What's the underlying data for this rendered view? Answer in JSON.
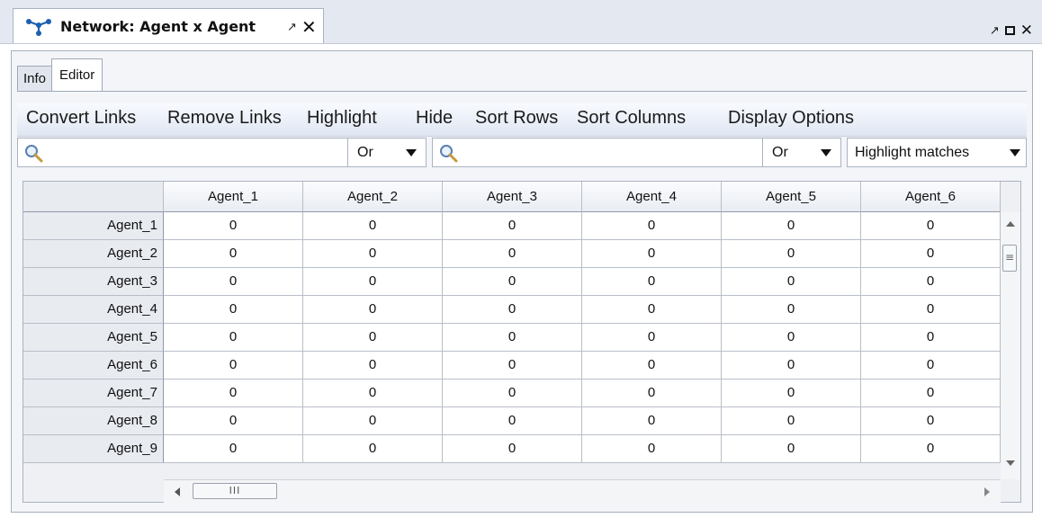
{
  "window": {
    "tab_title": "Network: Agent x Agent",
    "icons": [
      "network-icon",
      "undock-icon",
      "close-icon",
      "maximize-icon"
    ]
  },
  "subtabs": [
    {
      "label": "Info",
      "active": false
    },
    {
      "label": "Editor",
      "active": true
    }
  ],
  "menu": {
    "items": [
      "Convert Links",
      "Remove Links",
      "Highlight",
      "Hide",
      "Sort Rows",
      "Sort Columns",
      "Display Options"
    ]
  },
  "search": {
    "row_filter": {
      "value": "",
      "icon": "search-icon"
    },
    "row_mode": "Or",
    "col_filter": {
      "value": "",
      "icon": "search-icon"
    },
    "col_mode": "Or",
    "highlight_mode": "Highlight matches"
  },
  "grid": {
    "columns": [
      "Agent_1",
      "Agent_2",
      "Agent_3",
      "Agent_4",
      "Agent_5",
      "Agent_6"
    ],
    "rows": [
      {
        "label": "Agent_1",
        "values": [
          "0",
          "0",
          "0",
          "0",
          "0",
          "0"
        ]
      },
      {
        "label": "Agent_2",
        "values": [
          "0",
          "0",
          "0",
          "0",
          "0",
          "0"
        ]
      },
      {
        "label": "Agent_3",
        "values": [
          "0",
          "0",
          "0",
          "0",
          "0",
          "0"
        ]
      },
      {
        "label": "Agent_4",
        "values": [
          "0",
          "0",
          "0",
          "0",
          "0",
          "0"
        ]
      },
      {
        "label": "Agent_5",
        "values": [
          "0",
          "0",
          "0",
          "0",
          "0",
          "0"
        ]
      },
      {
        "label": "Agent_6",
        "values": [
          "0",
          "0",
          "0",
          "0",
          "0",
          "0"
        ]
      },
      {
        "label": "Agent_7",
        "values": [
          "0",
          "0",
          "0",
          "0",
          "0",
          "0"
        ]
      },
      {
        "label": "Agent_8",
        "values": [
          "0",
          "0",
          "0",
          "0",
          "0",
          "0"
        ]
      },
      {
        "label": "Agent_9",
        "values": [
          "0",
          "0",
          "0",
          "0",
          "0",
          "0"
        ]
      }
    ]
  }
}
